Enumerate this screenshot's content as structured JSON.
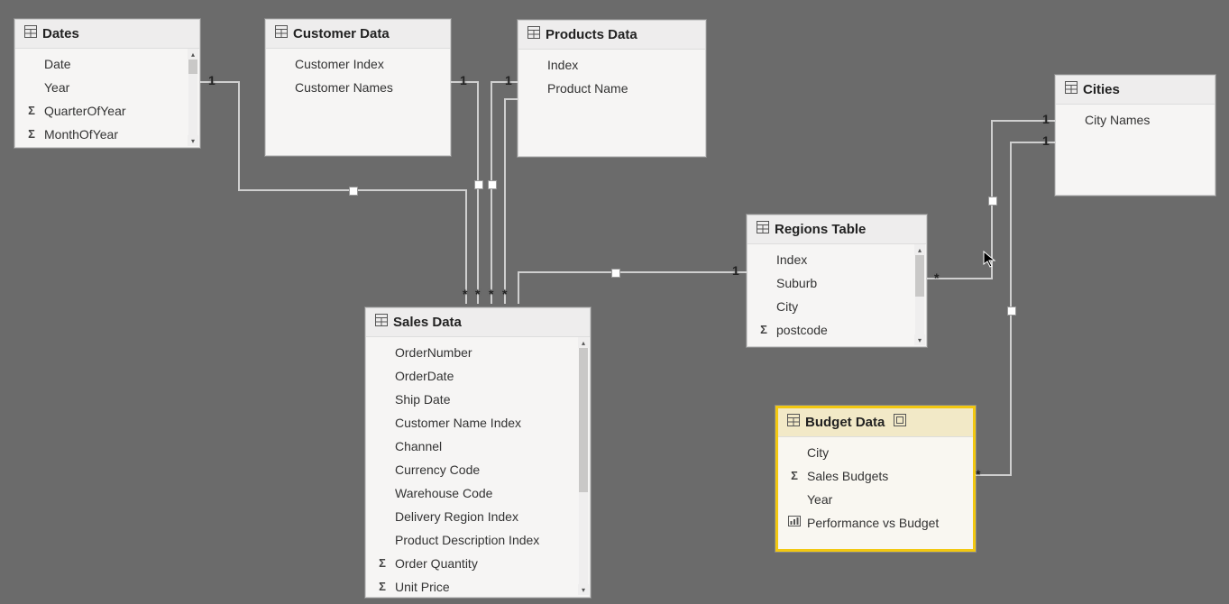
{
  "tables": {
    "dates": {
      "title": "Dates",
      "fields": [
        {
          "icon": "",
          "label": "Date"
        },
        {
          "icon": "",
          "label": "Year"
        },
        {
          "icon": "Σ",
          "label": "QuarterOfYear"
        },
        {
          "icon": "Σ",
          "label": "MonthOfYear"
        }
      ]
    },
    "customer": {
      "title": "Customer Data",
      "fields": [
        {
          "icon": "",
          "label": "Customer Index"
        },
        {
          "icon": "",
          "label": "Customer Names"
        }
      ]
    },
    "products": {
      "title": "Products Data",
      "fields": [
        {
          "icon": "",
          "label": "Index"
        },
        {
          "icon": "",
          "label": "Product Name"
        }
      ]
    },
    "cities": {
      "title": "Cities",
      "fields": [
        {
          "icon": "",
          "label": "City Names"
        }
      ]
    },
    "regions": {
      "title": "Regions Table",
      "fields": [
        {
          "icon": "",
          "label": "Index"
        },
        {
          "icon": "",
          "label": "Suburb"
        },
        {
          "icon": "",
          "label": "City"
        },
        {
          "icon": "Σ",
          "label": "postcode"
        }
      ]
    },
    "sales": {
      "title": "Sales Data",
      "fields": [
        {
          "icon": "",
          "label": "OrderNumber"
        },
        {
          "icon": "",
          "label": "OrderDate"
        },
        {
          "icon": "",
          "label": "Ship Date"
        },
        {
          "icon": "",
          "label": "Customer Name Index"
        },
        {
          "icon": "",
          "label": "Channel"
        },
        {
          "icon": "",
          "label": "Currency Code"
        },
        {
          "icon": "",
          "label": "Warehouse Code"
        },
        {
          "icon": "",
          "label": "Delivery Region Index"
        },
        {
          "icon": "",
          "label": "Product Description Index"
        },
        {
          "icon": "Σ",
          "label": "Order Quantity"
        },
        {
          "icon": "Σ",
          "label": "Unit Price"
        }
      ]
    },
    "budget": {
      "title": "Budget Data",
      "fields": [
        {
          "icon": "",
          "label": "City"
        },
        {
          "icon": "Σ",
          "label": "Sales Budgets"
        },
        {
          "icon": "",
          "label": "Year"
        },
        {
          "icon": "measure",
          "label": "Performance vs Budget"
        }
      ]
    }
  },
  "relationships": {
    "cardinalities": {
      "dates_side": "1",
      "customer_side": "1",
      "products_side": "1",
      "regions_side1": "1",
      "cities_side1": "1",
      "cities_side2": "1",
      "sales_side_star1": "*",
      "sales_side_star2": "*",
      "sales_side_star3": "*",
      "sales_side_star4": "*",
      "regions_star": "*",
      "budget_star": "*"
    }
  }
}
